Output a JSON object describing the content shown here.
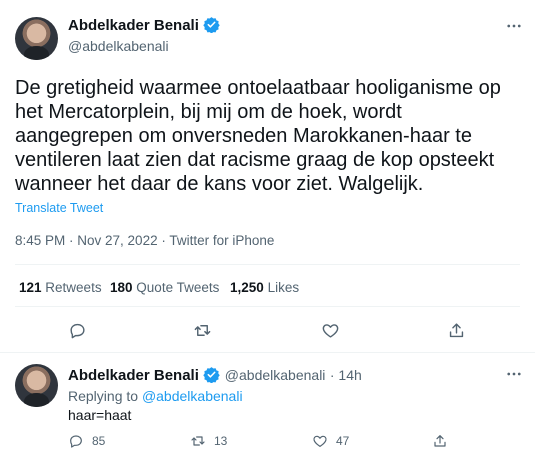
{
  "main_tweet": {
    "author_name": "Abdelkader Benali",
    "author_handle": "@abdelkabenali",
    "text": "De gretigheid waarmee ontoelaatbaar hooliganisme op\nhet Mercatorplein, bij mij om de hoek, wordt\naangegrepen om onversneden Marokkanen-haar te\nventileren laat zien dat racisme graag de kop opsteekt\nwanneer het daar de kans voor ziet. Walgelijk.",
    "translate_label": "Translate Tweet",
    "timestamp": "8:45 PM · Nov 27, 2022 · Twitter for iPhone",
    "retweets_count": "121",
    "retweets_label": "Retweets",
    "quotes_count": "180",
    "quotes_label": "Quote Tweets",
    "likes_count": "1,250",
    "likes_label": "Likes"
  },
  "reply": {
    "author_name": "Abdelkader Benali",
    "author_handle": "@abdelkabenali",
    "time": "· 14h",
    "replying_prefix": "Replying to",
    "replying_to": "@abdelkabenali",
    "text": "haar=haat",
    "reply_count": "85",
    "retweet_count": "13",
    "like_count": "47"
  },
  "colors": {
    "accent": "#1d9bf0",
    "text": "#0f1419",
    "muted": "#536471",
    "divider": "#eff3f4"
  }
}
